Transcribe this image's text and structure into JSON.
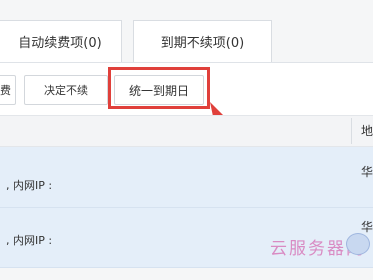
{
  "tabs": [
    {
      "label": "自动续费项(0)"
    },
    {
      "label": "到期不续项(0)"
    }
  ],
  "toolbar": {
    "partial_label": "费",
    "decide_label": "决定不续",
    "unify_label": "统一到期日"
  },
  "table": {
    "header_partial": "地",
    "rows": [
      {
        "text": ", 内网IP :",
        "region": "华"
      },
      {
        "text": ", 内网IP :",
        "region": "华"
      }
    ]
  },
  "colors": {
    "highlight": "#e0403b",
    "row_selected": "#e4eef9"
  },
  "watermark": {
    "text": "云服务器网"
  }
}
